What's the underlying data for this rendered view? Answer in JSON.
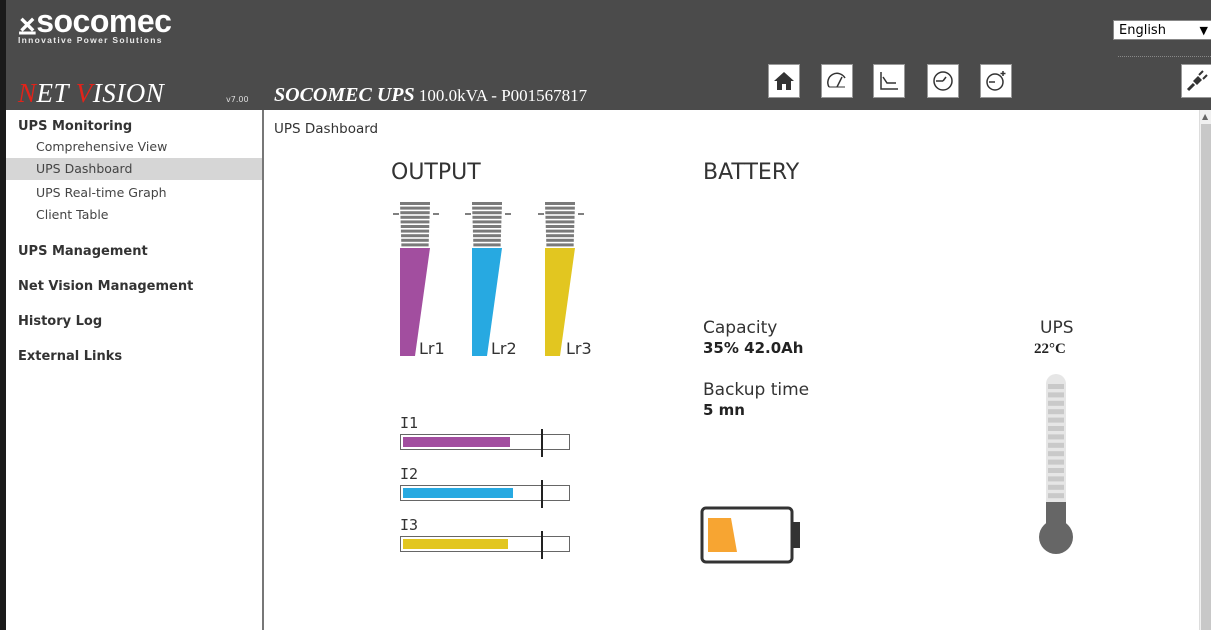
{
  "brand": {
    "logo": "socomec",
    "tagline": "Innovative Power Solutions",
    "product_n": "N",
    "product_et": "ET ",
    "product_v": "V",
    "product_ision": "ISION",
    "version": "v7.00"
  },
  "device": {
    "name": "SOCOMEC UPS",
    "rating": "100.0kVA - P001567817"
  },
  "language": {
    "selected": "English"
  },
  "toolbar": {
    "icons": [
      "home-icon",
      "gauge-icon",
      "graph-icon",
      "history-icon",
      "schedule-icon",
      "plug-icon"
    ]
  },
  "sidebar": {
    "ups_monitoring": "UPS Monitoring",
    "items": [
      "Comprehensive View",
      "UPS Dashboard",
      "UPS Real-time Graph",
      "Client Table"
    ],
    "ups_management": "UPS Management",
    "net_vision_management": "Net Vision Management",
    "history_log": "History Log",
    "external_links": "External Links"
  },
  "breadcrumb": "UPS Dashboard",
  "output": {
    "title": "OUTPUT",
    "load_bars": [
      {
        "label": "Lr1",
        "color": "#a24e9f",
        "level": 0.6
      },
      {
        "label": "Lr2",
        "color": "#27a9e1",
        "level": 0.65
      },
      {
        "label": "Lr3",
        "color": "#e2c620",
        "level": 0.65
      }
    ],
    "currents": [
      {
        "label": "I1",
        "color": "#a24e9f",
        "level": 0.65
      },
      {
        "label": "I2",
        "color": "#27a9e1",
        "level": 0.67
      },
      {
        "label": "I3",
        "color": "#e2c620",
        "level": 0.64
      }
    ]
  },
  "battery": {
    "title": "BATTERY",
    "capacity_label": "Capacity",
    "capacity_value": "35% 42.0Ah",
    "backup_label": "Backup time",
    "backup_value": "5 mn",
    "charge_color": "#f7a532",
    "charge_level": 0.35
  },
  "temperature": {
    "label": "UPS",
    "value": "22°C"
  }
}
